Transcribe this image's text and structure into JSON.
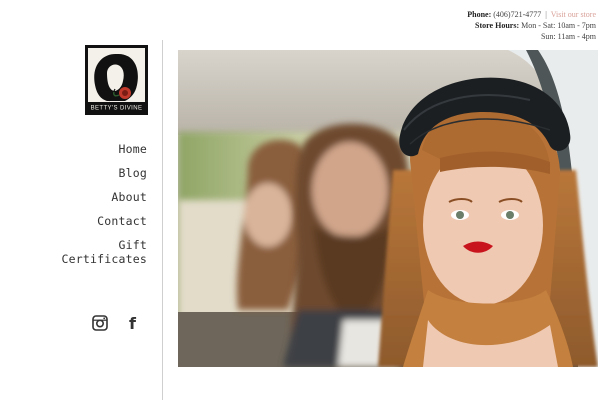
{
  "header": {
    "phone_label": "Phone:",
    "phone_number": "(406)721-4777",
    "separator": "|",
    "visit_link": "Visit our store",
    "hours_label": "Store Hours:",
    "hours_weekday": "Mon - Sat: 10am - 7pm",
    "hours_sunday": "Sun: 11am - 4pm"
  },
  "logo": {
    "text": "BETTY'S DIVINE",
    "colors": {
      "background": "#111111",
      "accent": "#c0392b"
    }
  },
  "nav": {
    "items": [
      {
        "label": "Home"
      },
      {
        "label": "Blog"
      },
      {
        "label": "About"
      },
      {
        "label": "Contact"
      },
      {
        "label_line1": "Gift",
        "label_line2": "Certificates"
      }
    ]
  },
  "social": {
    "icons": [
      "instagram-icon",
      "facebook-icon"
    ],
    "facebook_glyph": "f"
  },
  "colors": {
    "link": "#d9a29a",
    "divider": "#cfcfcf",
    "nav_text": "#333333"
  }
}
